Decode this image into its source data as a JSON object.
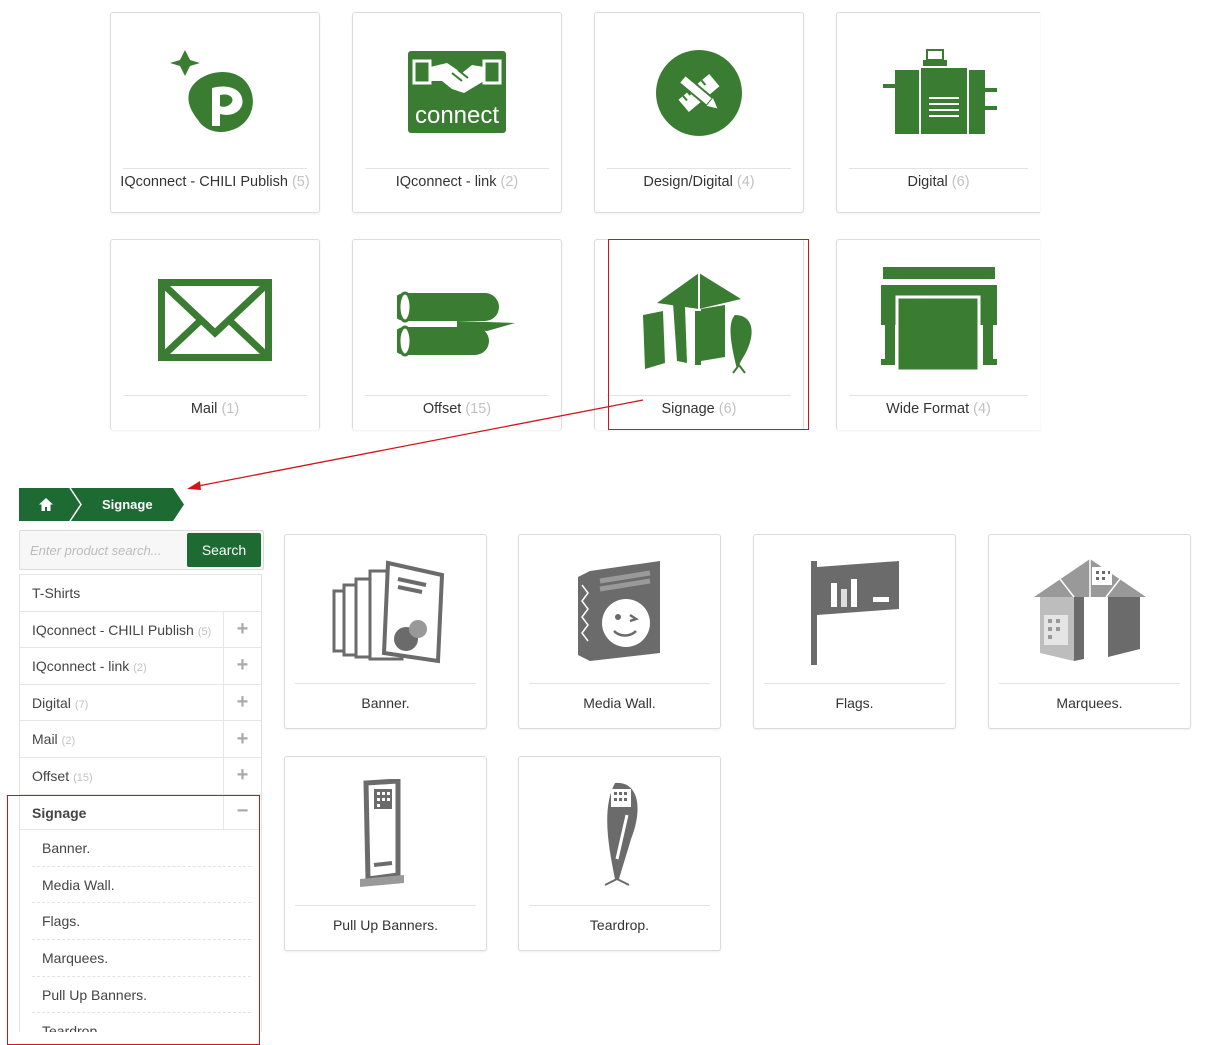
{
  "categories": [
    {
      "name": "IQconnect - CHILI Publish",
      "count": "(5)",
      "icon": "chili-publish-logo"
    },
    {
      "name": "IQconnect - link",
      "count": "(2)",
      "icon": "connect-handshake-logo"
    },
    {
      "name": "Design/Digital",
      "count": "(4)",
      "icon": "design-tools-icon"
    },
    {
      "name": "Digital",
      "count": "(6)",
      "icon": "digital-press-icon"
    },
    {
      "name": "Mail",
      "count": "(1)",
      "icon": "envelope-icon"
    },
    {
      "name": "Offset",
      "count": "(15)",
      "icon": "offset-rollers-icon"
    },
    {
      "name": "Signage",
      "count": "(6)",
      "icon": "signage-tent-icon"
    },
    {
      "name": "Wide Format",
      "count": "(4)",
      "icon": "wide-format-printer-icon"
    }
  ],
  "connect_logo_text": "connect",
  "breadcrumb": {
    "home_icon": "home-icon",
    "current": "Signage"
  },
  "search": {
    "placeholder": "Enter product search...",
    "button": "Search"
  },
  "sidebar": {
    "items": [
      {
        "label": "T-Shirts",
        "count": "",
        "toggle": ""
      },
      {
        "label": "IQconnect - CHILI Publish",
        "count": "(5)",
        "toggle": "+"
      },
      {
        "label": "IQconnect - link",
        "count": "(2)",
        "toggle": "+"
      },
      {
        "label": "Digital",
        "count": "(7)",
        "toggle": "+"
      },
      {
        "label": "Mail",
        "count": "(2)",
        "toggle": "+"
      },
      {
        "label": "Offset",
        "count": "(15)",
        "toggle": "+"
      },
      {
        "label": "Signage",
        "count": "",
        "toggle": "−"
      }
    ],
    "sub_items": [
      "Banner.",
      "Media Wall.",
      "Flags.",
      "Marquees.",
      "Pull Up Banners.",
      "Teardrop."
    ]
  },
  "products": [
    {
      "name": "Banner.",
      "icon": "banner-icon"
    },
    {
      "name": "Media Wall.",
      "icon": "media-wall-icon"
    },
    {
      "name": "Flags.",
      "icon": "flag-icon"
    },
    {
      "name": "Marquees.",
      "icon": "marquee-icon"
    },
    {
      "name": "Pull Up Banners.",
      "icon": "pull-up-banner-icon"
    },
    {
      "name": "Teardrop.",
      "icon": "teardrop-flag-icon"
    }
  ],
  "colors": {
    "brand_green": "#3a7d32",
    "dark_green": "#1d6b33",
    "annotation_red": "#d1141c",
    "icon_gray": "#6b6b6b"
  }
}
